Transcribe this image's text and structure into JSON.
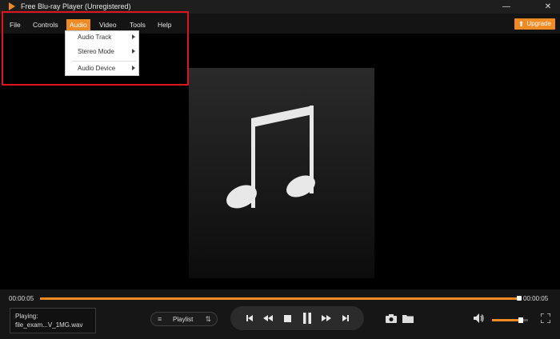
{
  "window": {
    "title": "Free Blu-ray Player (Unregistered)",
    "minimize_glyph": "—",
    "close_glyph": "✕"
  },
  "menubar": {
    "items": [
      "File",
      "Controls",
      "Audio",
      "Video",
      "Tools",
      "Help"
    ],
    "active": "Audio",
    "upgrade_label": "Upgrade"
  },
  "audio_menu": {
    "items": [
      "Audio Track",
      "Stereo Mode",
      "Audio Device"
    ]
  },
  "player": {
    "current_time": "00:00:05",
    "total_time": "00:00:05",
    "progress": 0.99,
    "playing_label": "Playing:",
    "file_name": "file_exam...V_1MG.wav",
    "playlist_label": "Playlist",
    "volume": 0.75
  },
  "colors": {
    "accent": "#f08a24",
    "highlight_border": "#e0141e"
  },
  "icons": [
    "app-logo-icon",
    "music-note-icon",
    "skip-previous-icon",
    "rewind-icon",
    "stop-icon",
    "pause-icon",
    "fast-forward-icon",
    "skip-next-icon",
    "snapshot-icon",
    "open-folder-icon",
    "volume-icon",
    "fullscreen-icon",
    "playlist-icon",
    "playlist-order-icon",
    "upgrade-arrow-icon"
  ]
}
